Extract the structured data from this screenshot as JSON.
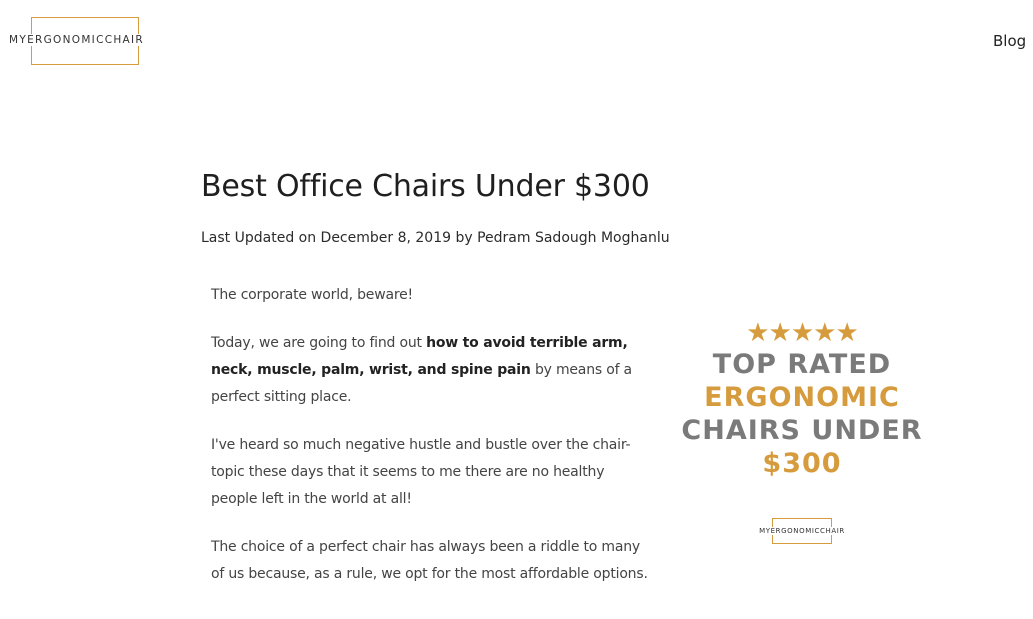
{
  "header": {
    "logo_text": "MYERGONOMICCHAIR",
    "nav_blog": "Blog"
  },
  "article": {
    "title": "Best Office Chairs Under $300",
    "meta": "Last Updated on December 8, 2019 by Pedram Sadough Moghanlu",
    "p1": "The corporate world, beware!",
    "p2_before": "Today, we are going to find out ",
    "p2_bold": "how to avoid terrible arm, neck, muscle, palm, wrist, and spine pain",
    "p2_after": " by means of a perfect sitting place.",
    "p3": "I've heard so much negative hustle and bustle over the chair-topic these days that it seems to me there are no healthy people left in the world at all!",
    "p4": "The choice of a perfect chair has always been a riddle to many of us because, as a rule, we opt for the most affordable options."
  },
  "promo": {
    "stars": "★★★★★",
    "line1": "TOP RATED",
    "line2": "ERGONOMIC",
    "line3": "CHAIRS UNDER",
    "line4": "$300",
    "logo_text": "MYERGONOMICCHAIR"
  },
  "colors": {
    "accent_gold": "#d59b3c",
    "promo_gray": "#7a7a7a",
    "text_dark": "#222222"
  }
}
